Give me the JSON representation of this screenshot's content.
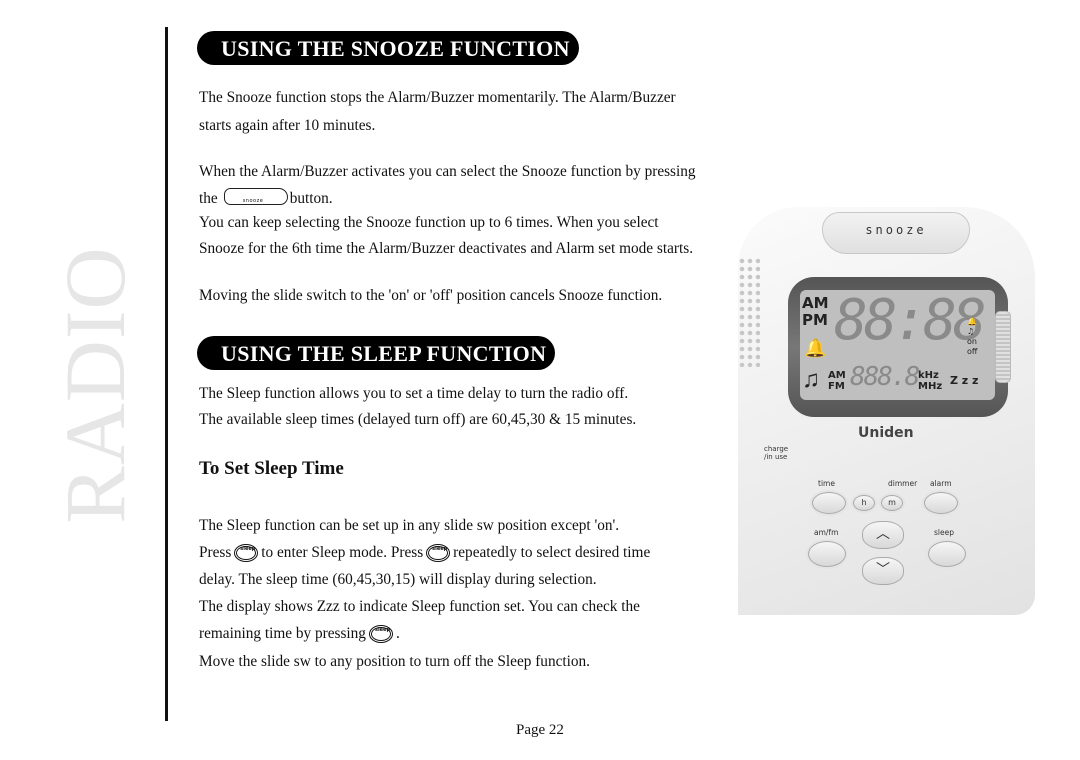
{
  "section_label": "RADIO",
  "snooze": {
    "heading": "USING THE SNOOZE FUNCTION",
    "p1_line1": "The Snooze function stops the Alarm/Buzzer momentarily. The Alarm/Buzzer",
    "p1_line2": "starts again after 10 minutes.",
    "p2_line1": "When the Alarm/Buzzer activates you can select the Snooze function by pressing",
    "p2_line2_pre": "the",
    "p2_line2_post": "button.",
    "p3_line1": "You can keep selecting the Snooze function up to 6 times. When you select",
    "p3_line2": "Snooze for the 6th time the Alarm/Buzzer deactivates and Alarm set mode starts.",
    "p4": "Moving the slide switch to the 'on' or 'off' position cancels Snooze function."
  },
  "sleep": {
    "heading": "USING THE SLEEP FUNCTION",
    "p1": "The Sleep function allows you to set a time delay to turn the radio off.",
    "p2": "The available sleep times (delayed turn off) are 60,45,30 & 15 minutes.",
    "subheading": "To Set Sleep Time",
    "s1": "The Sleep function can be set up in any slide sw position except 'on'.",
    "s2_a": "Press",
    "s2_b": "to enter Sleep mode. Press",
    "s2_c": "repeatedly to select desired time",
    "s3": "delay. The sleep time (60,45,30,15) will display during selection.",
    "s4": "The display shows Zzz to indicate Sleep function set. You can check the",
    "s5_a": "remaining time by pressing",
    "s5_b": ".",
    "s6": "Move the slide sw to any position to turn off the Sleep function."
  },
  "device": {
    "snooze_key": "snooze",
    "am": "AM",
    "pm": "PM",
    "clock": "88:88",
    "band_am": "AM",
    "band_fm": "FM",
    "freq": "888.8",
    "unit_khz": "kHz",
    "unit_mhz": "MHz",
    "zzz": "Z z z",
    "switch_on": "on",
    "switch_off": "off",
    "brand": "Uniden",
    "charge_label": "charge /in use",
    "buttons": {
      "time": "time",
      "dimmer": "dimmer",
      "alarm": "alarm",
      "h": "h",
      "m": "m",
      "am_fm": "am/fm",
      "sleep": "sleep",
      "up": "︿",
      "down": "﹀"
    }
  },
  "footer": {
    "page": "Page 22"
  }
}
